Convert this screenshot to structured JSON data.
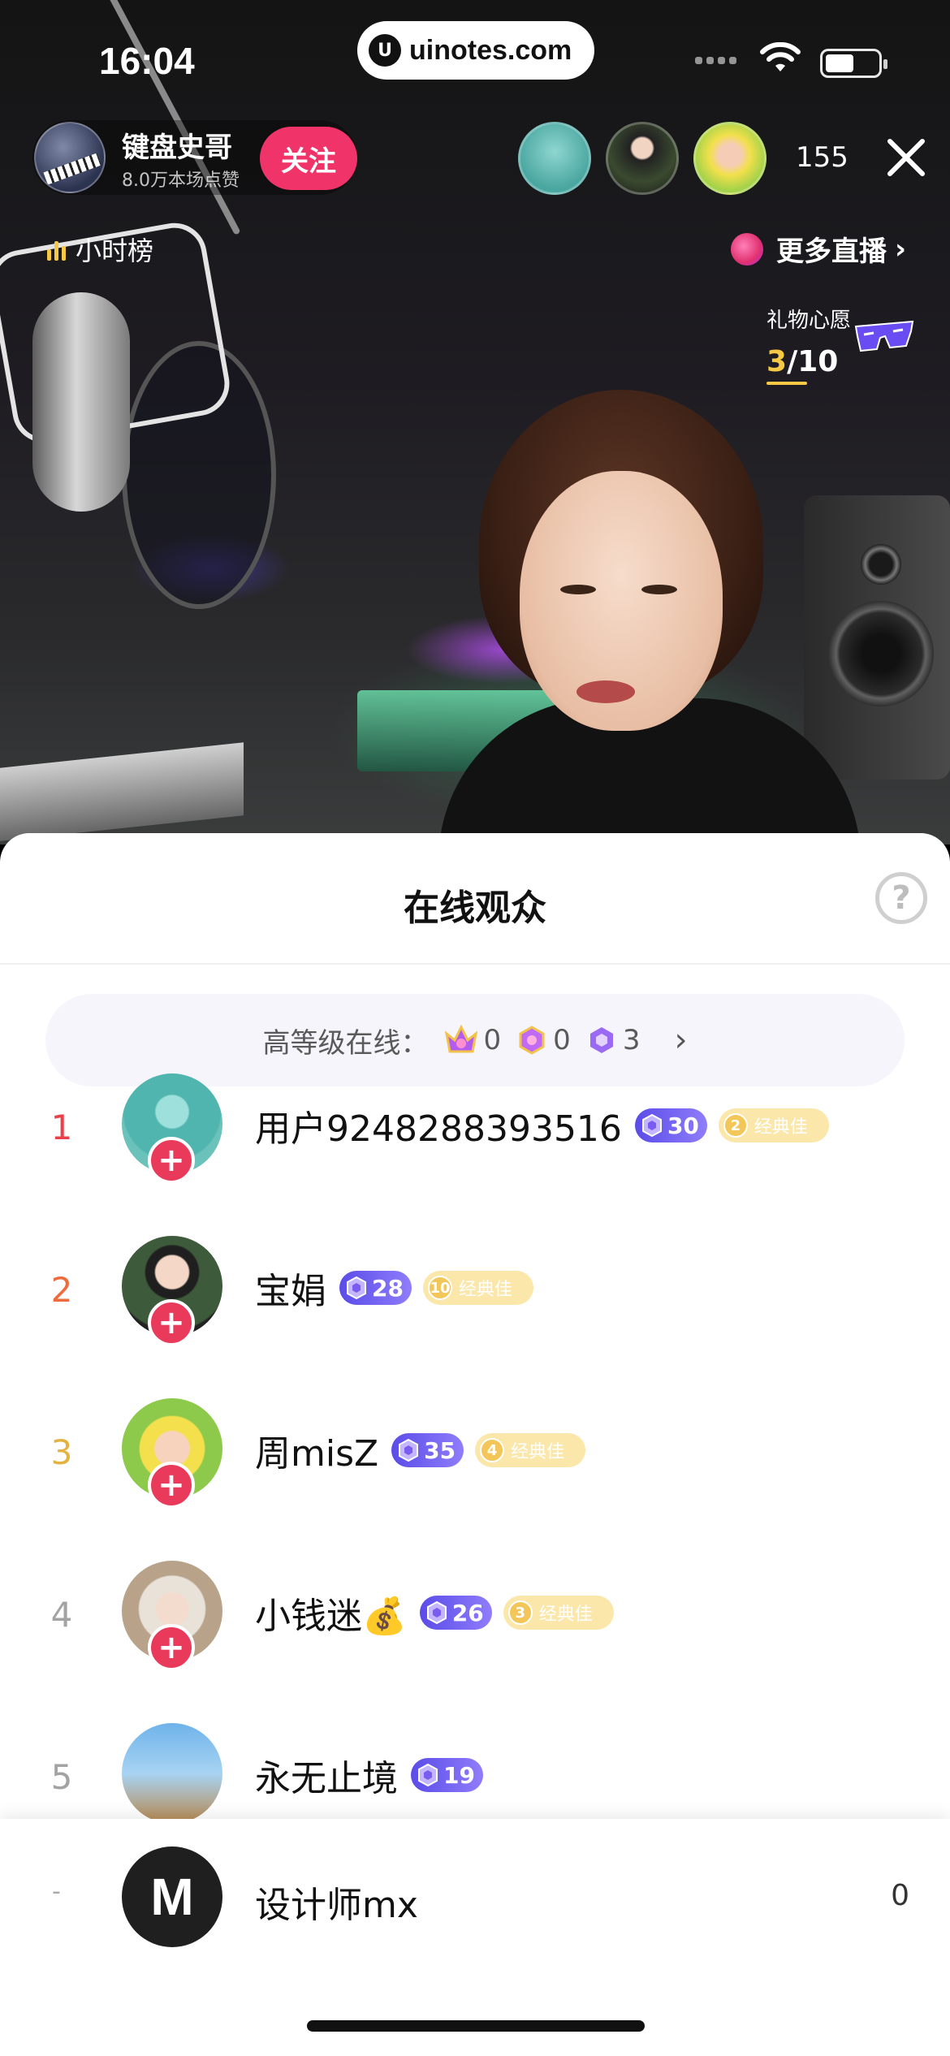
{
  "status_bar": {
    "time": "16:04",
    "url": "uinotes.com"
  },
  "stream": {
    "host": {
      "name": "键盘史哥",
      "likes": "8.0万本场点赞",
      "follow_label": "关注"
    },
    "viewer_count": "155",
    "hour_rank_label": "小时榜",
    "more_live_label": "更多直播",
    "gift_wish": {
      "title": "礼物心愿",
      "current": "3",
      "total": "/10"
    }
  },
  "sheet": {
    "title": "在线观众",
    "help_icon": "?",
    "high_level": {
      "label": "高等级在线：",
      "counts": [
        "0",
        "0",
        "3"
      ],
      "chevron": "›"
    },
    "viewers": [
      {
        "rank": "1",
        "rank_color": "#e8414a",
        "name": "用户9248288393516",
        "level": "30",
        "fan_level": "2",
        "fan_label": "经典佳"
      },
      {
        "rank": "2",
        "rank_color": "#ee6b3c",
        "name": "宝娟",
        "level": "28",
        "fan_level": "10",
        "fan_label": "经典佳"
      },
      {
        "rank": "3",
        "rank_color": "#e3b341",
        "name": "周misZ",
        "level": "35",
        "fan_level": "4",
        "fan_label": "经典佳"
      },
      {
        "rank": "4",
        "rank_color": "#a3a3a3",
        "name": "小钱迷💰",
        "level": "26",
        "fan_level": "3",
        "fan_label": "经典佳"
      },
      {
        "rank": "5",
        "rank_color": "#a3a3a3",
        "name": "永无止境",
        "level": "19",
        "fan_level": "",
        "fan_label": ""
      }
    ],
    "self": {
      "rank": "-",
      "avatar_letter": "M",
      "name": "设计师mx",
      "score": "0"
    }
  },
  "colors": {
    "follow": "#f0346a",
    "add_button": "#ea3a5c",
    "level_badge": "#6a5af0",
    "fan_badge": "#fbe7a9"
  }
}
